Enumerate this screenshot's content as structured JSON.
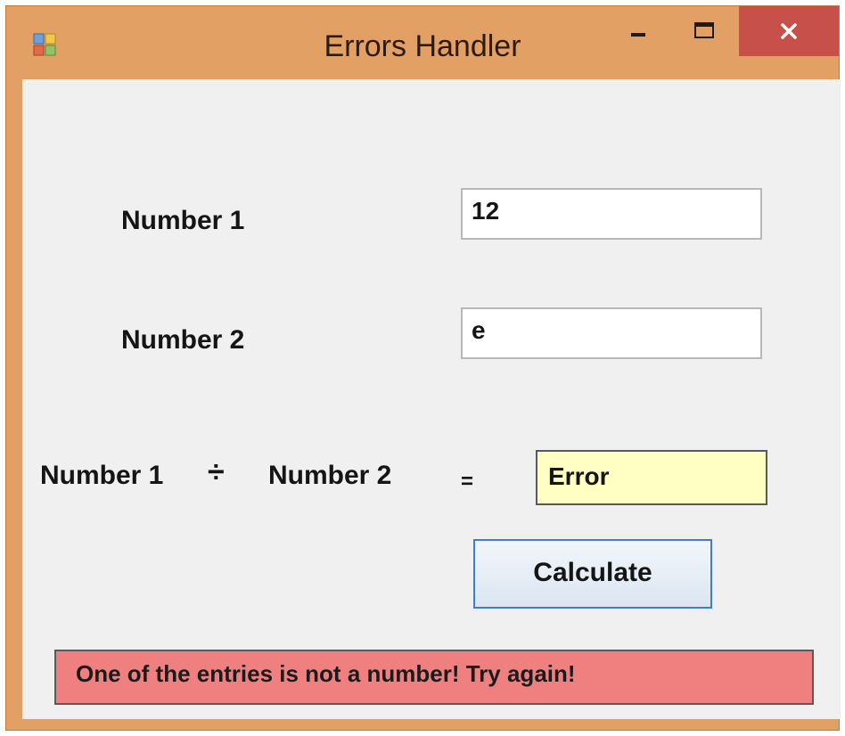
{
  "window": {
    "title": "Errors Handler",
    "controls": {
      "minimize": "minimize-icon",
      "maximize": "maximize-icon",
      "close": "close-icon"
    },
    "frame_color": "#e3a065",
    "close_color": "#c7504b"
  },
  "form": {
    "number1_label": "Number 1",
    "number1_value": "12",
    "number2_label": "Number 2",
    "number2_value": "e",
    "expression": {
      "left": "Number 1",
      "operator": "÷",
      "right": "Number 2",
      "equals": "="
    },
    "result_value": "Error",
    "calculate_label": "Calculate",
    "error_message": "One of the entries is not a number! Try again!"
  },
  "colors": {
    "result_background": "#ffffc4",
    "error_background": "#f08080",
    "button_border": "#3c7fd0"
  }
}
